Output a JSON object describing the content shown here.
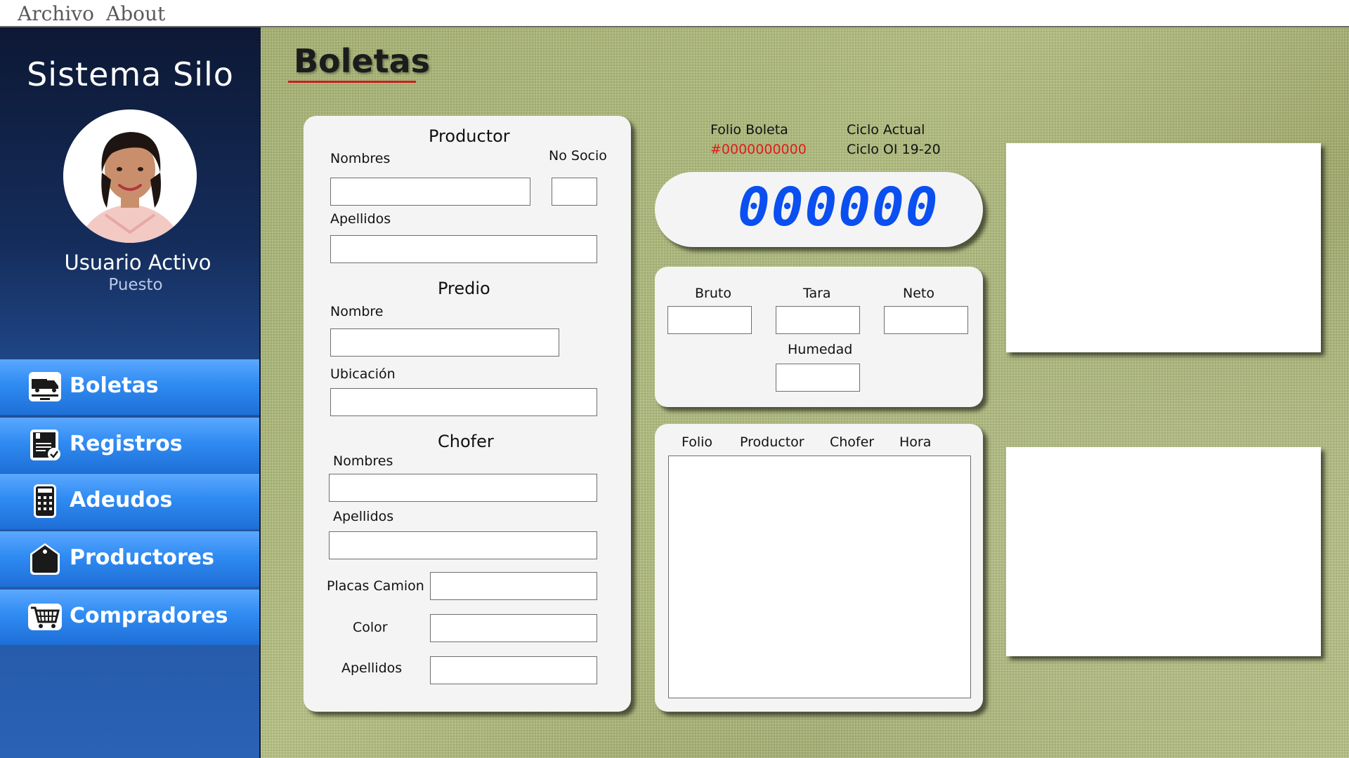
{
  "menu": {
    "items": [
      "Archivo",
      "About"
    ]
  },
  "sidebar": {
    "app_title": "Sistema Silo",
    "user_name": "Usuario Activo",
    "user_role": "Puesto",
    "nav": [
      {
        "label": "Boletas",
        "icon": "truck-icon"
      },
      {
        "label": "Registros",
        "icon": "register-icon"
      },
      {
        "label": "Adeudos",
        "icon": "calculator-icon"
      },
      {
        "label": "Productores",
        "icon": "tag-icon"
      },
      {
        "label": "Compradores",
        "icon": "shopping-cart-icon"
      }
    ]
  },
  "main": {
    "page_title": "Boletas",
    "form": {
      "productor_title": "Productor",
      "nombres_label": "Nombres",
      "no_socio_label": "No Socio",
      "apellidos_label": "Apellidos",
      "predio_title": "Predio",
      "nombre_label": "Nombre",
      "ubicacion_label": "Ubicación",
      "chofer_title": "Chofer",
      "chofer_nombres_label": "Nombres",
      "chofer_apellidos_label": "Apellidos",
      "placas_label": "Placas Camion",
      "color_label": "Color",
      "apellidos2_label": "Apellidos"
    },
    "folio_label": "Folio Boleta",
    "folio_value": "#0000000000",
    "ciclo_label": "Ciclo Actual",
    "ciclo_value": "Ciclo OI 19-20",
    "display_value": "000000",
    "weights": {
      "bruto_label": "Bruto",
      "tara_label": "Tara",
      "neto_label": "Neto",
      "humedad_label": "Humedad"
    },
    "table": {
      "headers": [
        "Folio",
        "Productor",
        "Chofer",
        "Hora"
      ]
    }
  },
  "colors": {
    "accent_red": "#c81e1e",
    "folio_red": "#e21b1b",
    "display_blue": "#0b4ff0",
    "nav_blue": "#2f8bf2"
  }
}
